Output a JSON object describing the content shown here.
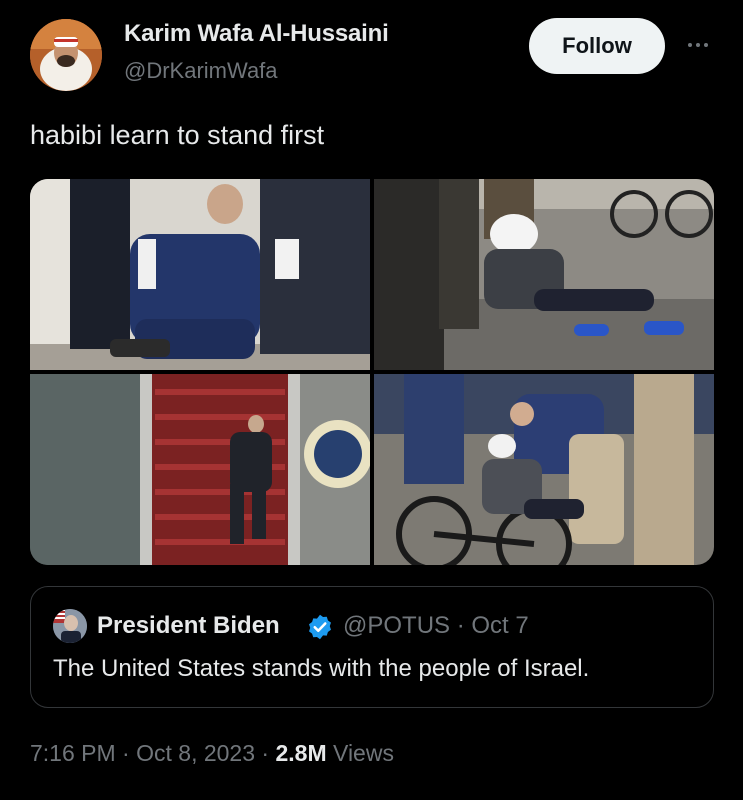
{
  "author": {
    "name": "Karim Wafa Al-Hussaini",
    "handle": "@DrKarimWafa",
    "avatar_icon": "profile-avatar"
  },
  "follow_label": "Follow",
  "more_icon": "ellipsis-icon",
  "tweet": {
    "text": "habibi learn to stand first"
  },
  "media": {
    "count": 4,
    "images": [
      {
        "icon": "photo-man-helped-up-after-fall"
      },
      {
        "icon": "photo-man-fallen-off-bicycle"
      },
      {
        "icon": "photo-man-stumbling-on-plane-stairs"
      },
      {
        "icon": "photo-man-fallen-with-bicycle-crowd"
      }
    ]
  },
  "quote": {
    "name": "President Biden",
    "handle_date": "@POTUS · Oct 7",
    "text": "The United States stands with the people of Israel.",
    "verified_icon": "verified-badge-icon"
  },
  "meta": {
    "time": "7:16 PM",
    "sep1": " · ",
    "date": "Oct 8, 2023",
    "sep2": " · ",
    "views_count": "2.8M",
    "views_label": " Views"
  },
  "colors": {
    "background": "#000000",
    "text_primary": "#e7e9ea",
    "text_secondary": "#71767b",
    "border": "#333639",
    "follow_bg": "#eff3f4",
    "verified": "#1d9bf0"
  }
}
